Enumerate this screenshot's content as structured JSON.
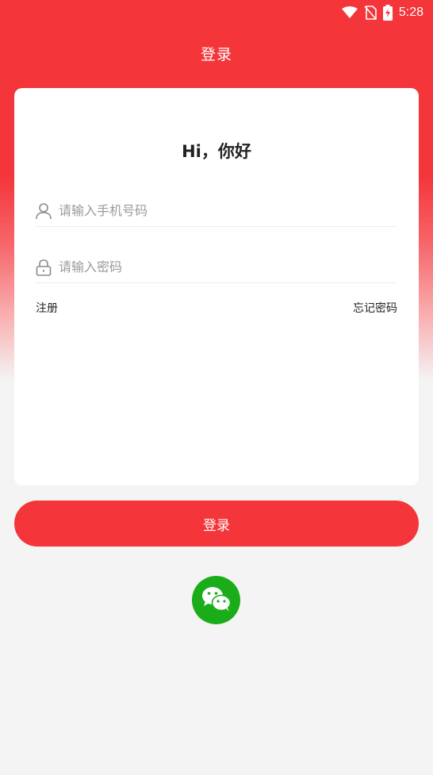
{
  "status_bar": {
    "time": "5:28",
    "icons": [
      "wifi-icon",
      "no-sim-icon",
      "battery-charging-icon"
    ]
  },
  "header": {
    "title": "登录"
  },
  "card": {
    "greeting": "Hi，你好",
    "phone_field": {
      "placeholder": "请输入手机号码",
      "value": "",
      "icon": "user-icon"
    },
    "password_field": {
      "placeholder": "请输入密码",
      "value": "",
      "icon": "lock-icon"
    },
    "register_label": "注册",
    "forgot_label": "忘记密码"
  },
  "login_button": {
    "label": "登录"
  },
  "social": {
    "icon": "wechat-icon"
  },
  "colors": {
    "accent": "#f4353a",
    "background": "#f4f4f4",
    "wechat_green": "#1aad19"
  }
}
